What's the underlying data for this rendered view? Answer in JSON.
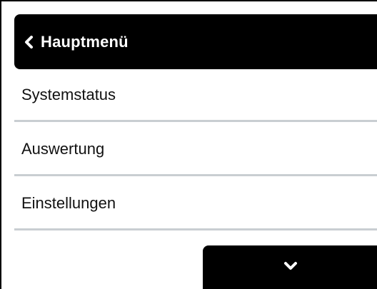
{
  "header": {
    "title": "Hauptmenü",
    "back_icon": "chevron-left-icon"
  },
  "menu": {
    "items": [
      {
        "label": "Systemstatus"
      },
      {
        "label": "Auswertung"
      },
      {
        "label": "Einstellungen"
      }
    ]
  },
  "scroll_down": {
    "icon": "chevron-down-icon"
  },
  "colors": {
    "bar_background": "#000000",
    "bar_text": "#ffffff",
    "divider": "#c9ced2",
    "item_text": "#111111"
  }
}
